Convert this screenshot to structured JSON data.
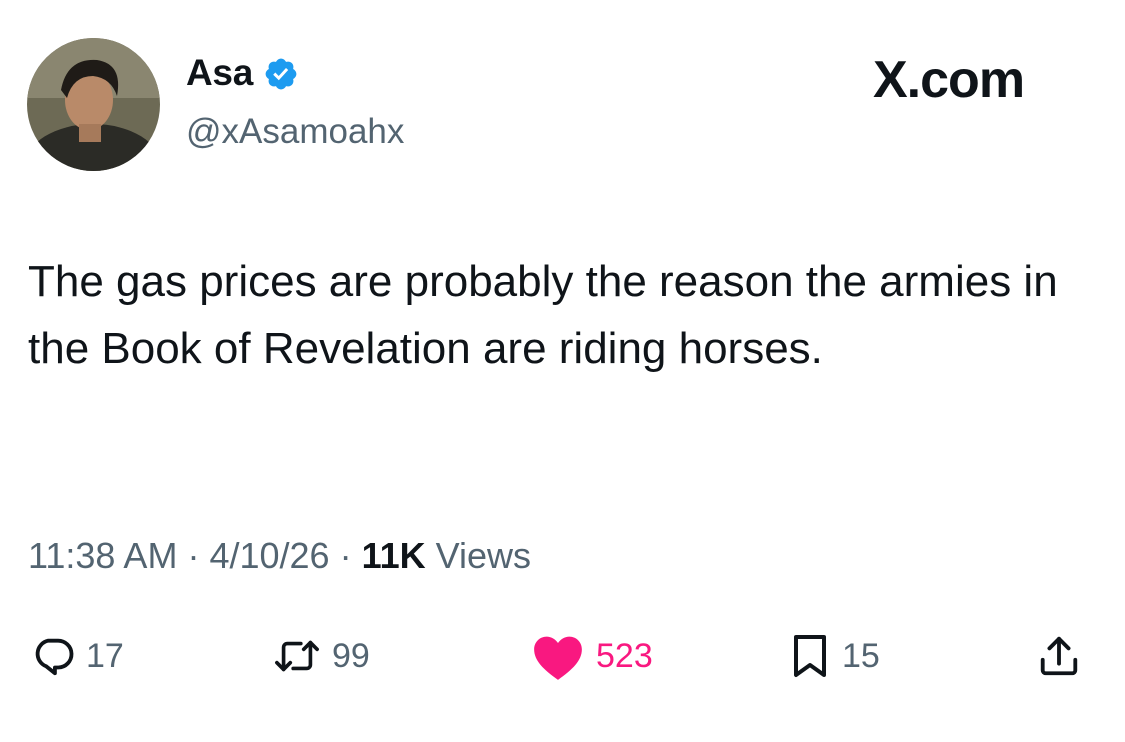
{
  "header": {
    "display_name": "Asa",
    "handle": "@xAsamoahx",
    "verified_icon": "verified-badge-icon",
    "brand": "X.com",
    "colors": {
      "verified": "#1d9bf0"
    }
  },
  "tweet": {
    "text": "The gas prices are probably the reason the armies in the Book of Revelation are riding horses."
  },
  "meta": {
    "time": "11:38 AM",
    "separator": " · ",
    "date": "4/10/26",
    "views_count": "11K",
    "views_label": " Views"
  },
  "actions": {
    "reply": {
      "icon": "reply-icon",
      "count": "17"
    },
    "repost": {
      "icon": "repost-icon",
      "count": "99"
    },
    "like": {
      "icon": "heart-icon",
      "count": "523",
      "liked": true,
      "color": "#f91880"
    },
    "bookmark": {
      "icon": "bookmark-icon",
      "count": "15"
    },
    "share": {
      "icon": "share-icon"
    }
  }
}
